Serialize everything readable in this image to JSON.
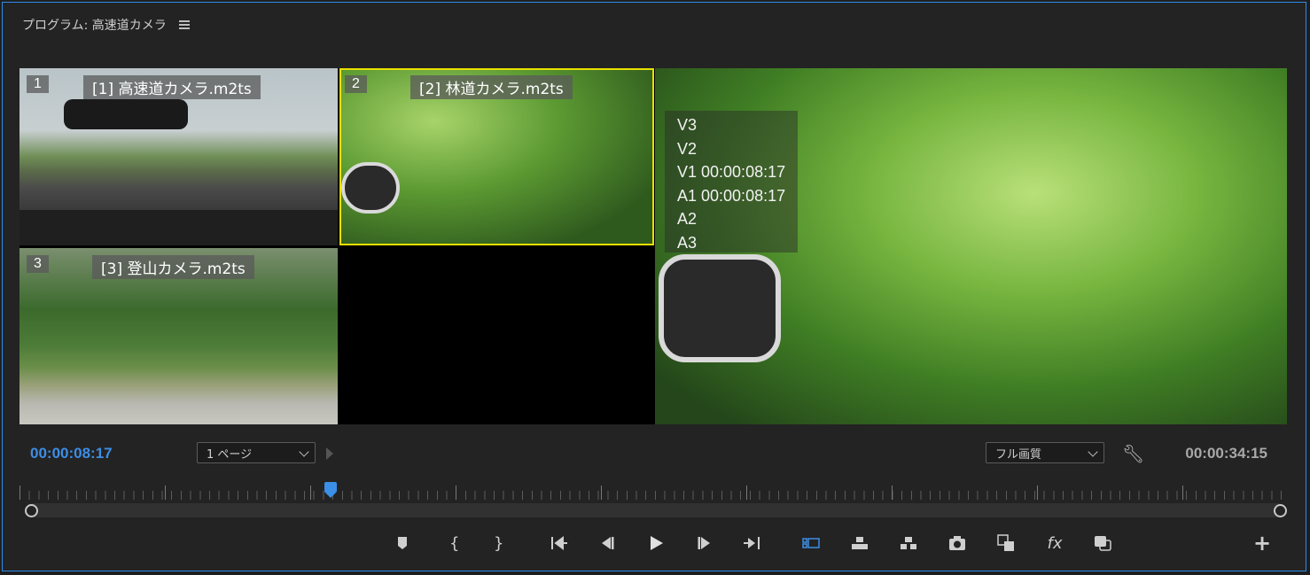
{
  "panel": {
    "title": "プログラム: 高速道カメラ"
  },
  "multicam": {
    "cameras": [
      {
        "number": "1",
        "name": "[1] 高速道カメラ.m2ts"
      },
      {
        "number": "2",
        "name": "[2] 林道カメラ.m2ts"
      },
      {
        "number": "3",
        "name": "[3] 登山カメラ.m2ts"
      }
    ],
    "tracks": [
      "V3",
      "V2",
      "V1 00:00:08:17",
      "A1 00:00:08:17",
      "A2",
      "A3"
    ]
  },
  "controls": {
    "current_timecode": "00:00:08:17",
    "duration_timecode": "00:00:34:15",
    "page_select": "1 ページ",
    "quality_select": "フル画質"
  },
  "colors": {
    "accent": "#3d8ee6",
    "selected_camera_border": "#e8e000",
    "panel_border": "#2d8ceb"
  },
  "toolbar": {
    "icons": [
      "marker-icon",
      "mark-in-icon",
      "mark-out-icon",
      "go-to-in-icon",
      "step-back-icon",
      "play-icon",
      "step-forward-icon",
      "go-to-out-icon",
      "multicam-view-icon",
      "lift-icon",
      "extract-icon",
      "export-frame-icon",
      "comparison-view-icon",
      "fx-icon",
      "proxy-toggle-icon",
      "add-button-icon"
    ],
    "fx_label": "fx",
    "add_label": "+"
  }
}
